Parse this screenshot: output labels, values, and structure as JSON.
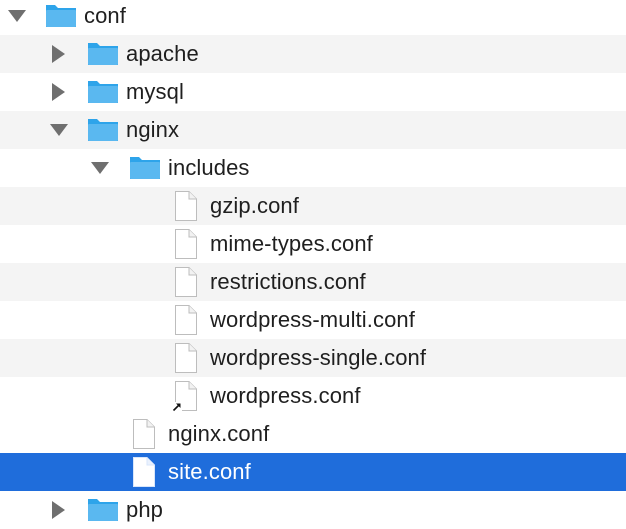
{
  "tree": {
    "root": {
      "label": "conf",
      "expanded": true
    },
    "apache": {
      "label": "apache",
      "expanded": false
    },
    "mysql": {
      "label": "mysql",
      "expanded": false
    },
    "nginx": {
      "label": "nginx",
      "expanded": true
    },
    "includes": {
      "label": "includes",
      "expanded": true
    },
    "include_files": [
      {
        "label": "gzip.conf"
      },
      {
        "label": "mime-types.conf"
      },
      {
        "label": "restrictions.conf"
      },
      {
        "label": "wordpress-multi.conf"
      },
      {
        "label": "wordpress-single.conf"
      },
      {
        "label": "wordpress.conf",
        "alias": true
      }
    ],
    "nginx_conf": {
      "label": "nginx.conf"
    },
    "site_conf": {
      "label": "site.conf",
      "selected": true
    },
    "php": {
      "label": "php",
      "expanded": false
    }
  },
  "colors": {
    "selection": "#1f6ddb",
    "folder": "#5ab8f0",
    "stripe": "#f4f4f4",
    "triangle": "#6f6f6f"
  }
}
